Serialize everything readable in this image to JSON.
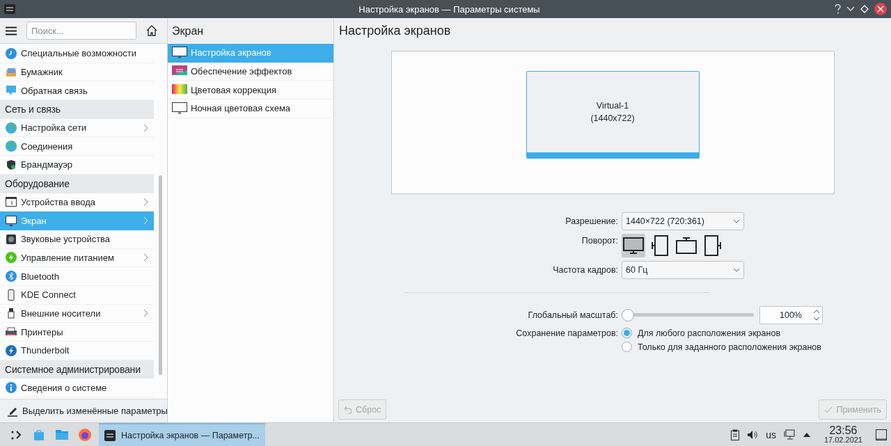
{
  "window": {
    "title": "Настройка экранов — Параметры системы"
  },
  "sidebar": {
    "search": {
      "placeholder": "Поиск..."
    },
    "items": [
      {
        "kind": "item",
        "label": "Специальные возможности",
        "selected": false,
        "has_children": false
      },
      {
        "kind": "item",
        "label": "Бумажник",
        "selected": false,
        "has_children": false
      },
      {
        "kind": "item",
        "label": "Обратная связь",
        "selected": false,
        "has_children": false
      },
      {
        "kind": "category",
        "label": "Сеть и связь"
      },
      {
        "kind": "item",
        "label": "Настройка сети",
        "selected": false,
        "has_children": true
      },
      {
        "kind": "item",
        "label": "Соединения",
        "selected": false,
        "has_children": false
      },
      {
        "kind": "item",
        "label": "Брандмауэр",
        "selected": false,
        "has_children": false
      },
      {
        "kind": "category",
        "label": "Оборудование"
      },
      {
        "kind": "item",
        "label": "Устройства ввода",
        "selected": false,
        "has_children": true
      },
      {
        "kind": "item",
        "label": "Экран",
        "selected": true,
        "has_children": true
      },
      {
        "kind": "item",
        "label": "Звуковые устройства",
        "selected": false,
        "has_children": false
      },
      {
        "kind": "item",
        "label": "Управление питанием",
        "selected": false,
        "has_children": true
      },
      {
        "kind": "item",
        "label": "Bluetooth",
        "selected": false,
        "has_children": false
      },
      {
        "kind": "item",
        "label": "KDE Connect",
        "selected": false,
        "has_children": false
      },
      {
        "kind": "item",
        "label": "Внешние носители",
        "selected": false,
        "has_children": true
      },
      {
        "kind": "item",
        "label": "Принтеры",
        "selected": false,
        "has_children": false
      },
      {
        "kind": "item",
        "label": "Thunderbolt",
        "selected": false,
        "has_children": false
      },
      {
        "kind": "category",
        "label": "Системное администрировани"
      },
      {
        "kind": "item",
        "label": "Сведения о системе",
        "selected": false,
        "has_children": false
      }
    ],
    "footer": "Выделить изменённые параметры"
  },
  "subpanel": {
    "title": "Экран",
    "items": [
      {
        "label": "Настройка экранов",
        "selected": true
      },
      {
        "label": "Обеспечение эффектов",
        "selected": false
      },
      {
        "label": "Цветовая коррекция",
        "selected": false
      },
      {
        "label": "Ночная цветовая схема",
        "selected": false
      }
    ]
  },
  "content": {
    "title": "Настройка экранов",
    "monitor": {
      "name": "Virtual-1",
      "size": "(1440x722)"
    },
    "resolution": {
      "label": "Разрешение:",
      "value": "1440×722 (720:361)"
    },
    "rotation": {
      "label": "Поворот:",
      "options": [
        {
          "kind": "normal",
          "selected": true
        },
        {
          "kind": "left",
          "selected": false
        },
        {
          "kind": "inverted",
          "selected": false
        },
        {
          "kind": "right",
          "selected": false
        }
      ]
    },
    "refresh": {
      "label": "Частота кадров:",
      "value": "60 Гц"
    },
    "scale": {
      "label": "Глобальный масштаб:",
      "level": 0,
      "value": "100%"
    },
    "save": {
      "label": "Сохранение параметров:",
      "options": [
        {
          "label": "Для любого расположения экранов",
          "selected": true
        },
        {
          "label": "Только для заданного расположения экранов",
          "selected": false
        }
      ]
    },
    "buttons": [
      {
        "kind": "reset",
        "label": "Сброс",
        "disabled": true
      },
      {
        "kind": "apply",
        "label": "Применить",
        "disabled": true
      }
    ]
  },
  "taskbar": {
    "task": {
      "label": "Настройка экранов  — Параметр...",
      "selected": true
    },
    "keyboard": "us",
    "time": "23:56",
    "date": "17.02.2021"
  }
}
